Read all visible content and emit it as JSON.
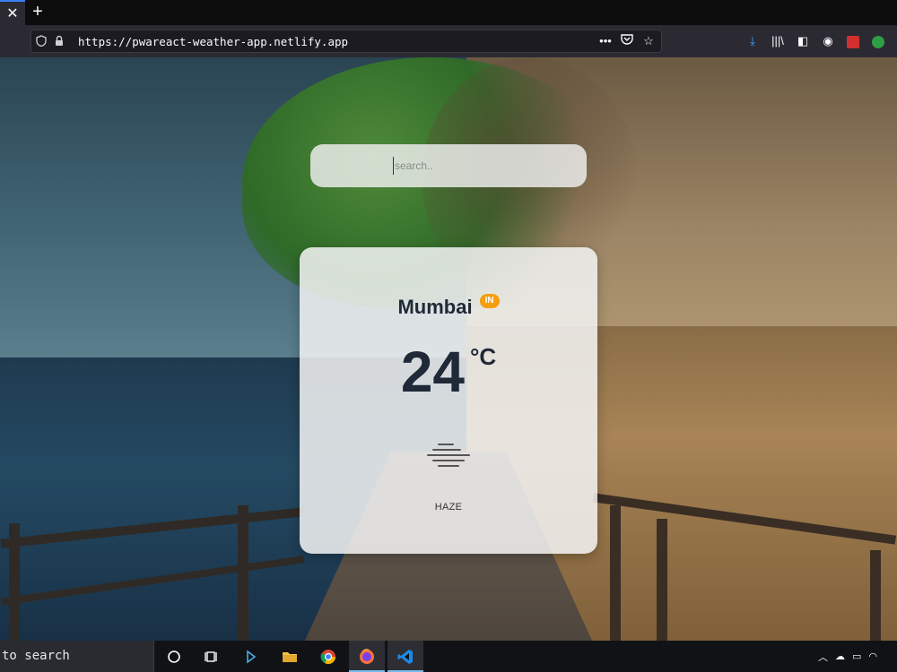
{
  "browser": {
    "tab_close_glyph": "✕",
    "new_tab_glyph": "+",
    "url": "https://pwareact-weather-app.netlify.app",
    "url_actions": [
      "page-actions-icon",
      "pocket-icon",
      "bookmark-star-icon"
    ],
    "toolbar_icons": [
      "download-icon",
      "library-icon",
      "sidebar-icon",
      "account-icon",
      "extension-red-icon",
      "extension-green-icon",
      "extension-teal-icon"
    ]
  },
  "app": {
    "search": {
      "placeholder": "search..",
      "value": ""
    },
    "weather": {
      "city": "Mumbai",
      "country": "IN",
      "temperature": "24",
      "unit": "°C",
      "icon": "haze-icon",
      "description": "HAZE"
    },
    "colors": {
      "badge": "#f59e0b",
      "text": "#1f2937"
    }
  },
  "taskbar": {
    "search_text": "to search",
    "items": [
      "cortana-icon",
      "task-view-icon",
      "app-arrow-icon",
      "file-explorer-icon",
      "chrome-icon",
      "firefox-icon",
      "vscode-icon"
    ],
    "tray": [
      "chevron-up-icon",
      "onedrive-icon",
      "battery-icon",
      "wifi-icon"
    ]
  }
}
